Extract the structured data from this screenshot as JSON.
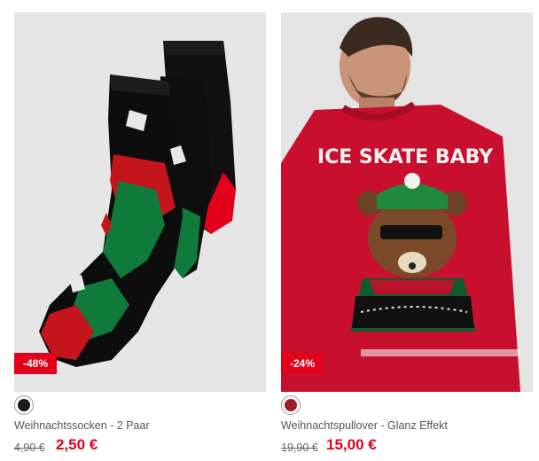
{
  "products": [
    {
      "name": "Weihnachtssocken - 2 Paar",
      "discount": "-48%",
      "old_price": "4,90 €",
      "new_price": "2,50 €",
      "swatch_color": "#1a1a1a",
      "image": "black-green-red-christmas-socks"
    },
    {
      "name": "Weihnachtspullover - Glanz Effekt",
      "discount": "-24%",
      "old_price": "19,90 €",
      "new_price": "15,00 €",
      "swatch_color": "#9b1c2a",
      "image": "red-christmas-sweater-bear",
      "sweater_text": "ICE SKATE BABY"
    }
  ],
  "colors": {
    "sale_red": "#e2001a",
    "image_bg": "#e6e6e6"
  }
}
